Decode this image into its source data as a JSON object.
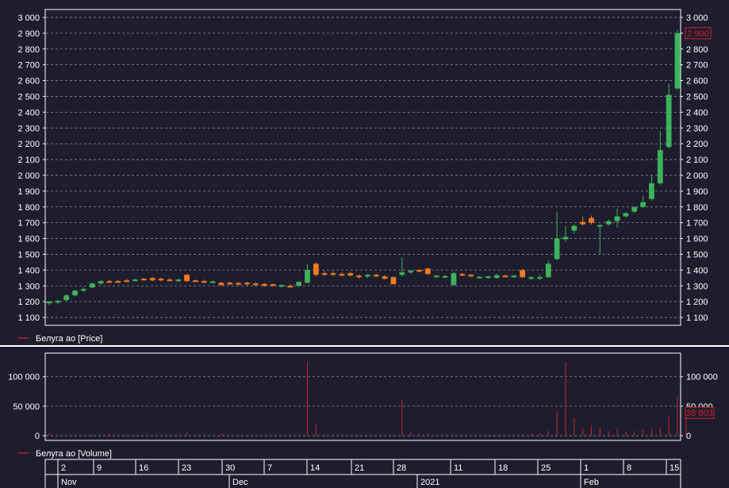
{
  "chart_data": [
    {
      "type": "candlestick",
      "panel": "price",
      "legend": "Белуга ао [Price]",
      "last_value_label": "2 900",
      "ylim": [
        1050,
        3050
      ],
      "y_ticks": [
        1100,
        1200,
        1300,
        1400,
        1500,
        1600,
        1700,
        1800,
        1900,
        2000,
        2100,
        2200,
        2300,
        2400,
        2500,
        2600,
        2700,
        2800,
        2900,
        3000
      ],
      "y_tick_labels": [
        "1 100",
        "1 200",
        "1 300",
        "1 400",
        "1 500",
        "1 600",
        "1 700",
        "1 800",
        "1 900",
        "2 000",
        "2 100",
        "2 200",
        "2 300",
        "2 400",
        "2 500",
        "2 600",
        "2 700",
        "2 800",
        "2 900",
        "3 000"
      ],
      "grid": true,
      "colors": {
        "up": "#3cb35a",
        "down": "#f47a1f",
        "accent": "#d0202a",
        "grid": "#8a8a9a",
        "axis": "#ffffff",
        "bg": "#1e1d2d"
      },
      "candles": [
        {
          "o": 1190,
          "h": 1205,
          "l": 1180,
          "c": 1200
        },
        {
          "o": 1200,
          "h": 1210,
          "l": 1185,
          "c": 1205
        },
        {
          "o": 1210,
          "h": 1245,
          "l": 1205,
          "c": 1240
        },
        {
          "o": 1240,
          "h": 1275,
          "l": 1235,
          "c": 1270
        },
        {
          "o": 1270,
          "h": 1290,
          "l": 1260,
          "c": 1280
        },
        {
          "o": 1290,
          "h": 1320,
          "l": 1285,
          "c": 1315
        },
        {
          "o": 1315,
          "h": 1335,
          "l": 1305,
          "c": 1330
        },
        {
          "o": 1330,
          "h": 1340,
          "l": 1320,
          "c": 1325
        },
        {
          "o": 1330,
          "h": 1338,
          "l": 1320,
          "c": 1325
        },
        {
          "o": 1335,
          "h": 1345,
          "l": 1325,
          "c": 1330
        },
        {
          "o": 1335,
          "h": 1345,
          "l": 1330,
          "c": 1340
        },
        {
          "o": 1345,
          "h": 1350,
          "l": 1335,
          "c": 1340
        },
        {
          "o": 1350,
          "h": 1355,
          "l": 1330,
          "c": 1335
        },
        {
          "o": 1345,
          "h": 1352,
          "l": 1330,
          "c": 1335
        },
        {
          "o": 1340,
          "h": 1350,
          "l": 1330,
          "c": 1335
        },
        {
          "o": 1335,
          "h": 1345,
          "l": 1325,
          "c": 1340
        },
        {
          "o": 1370,
          "h": 1375,
          "l": 1325,
          "c": 1330
        },
        {
          "o": 1335,
          "h": 1340,
          "l": 1325,
          "c": 1330
        },
        {
          "o": 1330,
          "h": 1340,
          "l": 1320,
          "c": 1325
        },
        {
          "o": 1325,
          "h": 1335,
          "l": 1320,
          "c": 1328
        },
        {
          "o": 1320,
          "h": 1325,
          "l": 1300,
          "c": 1305
        },
        {
          "o": 1320,
          "h": 1328,
          "l": 1305,
          "c": 1312
        },
        {
          "o": 1318,
          "h": 1325,
          "l": 1305,
          "c": 1310
        },
        {
          "o": 1320,
          "h": 1325,
          "l": 1300,
          "c": 1310
        },
        {
          "o": 1315,
          "h": 1322,
          "l": 1300,
          "c": 1305
        },
        {
          "o": 1312,
          "h": 1318,
          "l": 1295,
          "c": 1300
        },
        {
          "o": 1310,
          "h": 1315,
          "l": 1295,
          "c": 1300
        },
        {
          "o": 1300,
          "h": 1310,
          "l": 1290,
          "c": 1305
        },
        {
          "o": 1300,
          "h": 1310,
          "l": 1290,
          "c": 1298
        },
        {
          "o": 1300,
          "h": 1330,
          "l": 1295,
          "c": 1325
        },
        {
          "o": 1320,
          "h": 1440,
          "l": 1315,
          "c": 1400
        },
        {
          "o": 1440,
          "h": 1450,
          "l": 1360,
          "c": 1370
        },
        {
          "o": 1380,
          "h": 1395,
          "l": 1365,
          "c": 1375
        },
        {
          "o": 1380,
          "h": 1390,
          "l": 1360,
          "c": 1370
        },
        {
          "o": 1375,
          "h": 1385,
          "l": 1360,
          "c": 1370
        },
        {
          "o": 1380,
          "h": 1388,
          "l": 1360,
          "c": 1365
        },
        {
          "o": 1365,
          "h": 1372,
          "l": 1345,
          "c": 1355
        },
        {
          "o": 1362,
          "h": 1375,
          "l": 1350,
          "c": 1370
        },
        {
          "o": 1370,
          "h": 1378,
          "l": 1355,
          "c": 1365
        },
        {
          "o": 1360,
          "h": 1368,
          "l": 1340,
          "c": 1345
        },
        {
          "o": 1355,
          "h": 1360,
          "l": 1320,
          "c": 1310
        },
        {
          "o": 1370,
          "h": 1480,
          "l": 1360,
          "c": 1385
        },
        {
          "o": 1390,
          "h": 1400,
          "l": 1375,
          "c": 1395
        },
        {
          "o": 1400,
          "h": 1405,
          "l": 1385,
          "c": 1390
        },
        {
          "o": 1410,
          "h": 1415,
          "l": 1370,
          "c": 1375
        },
        {
          "o": 1360,
          "h": 1368,
          "l": 1350,
          "c": 1365
        },
        {
          "o": 1360,
          "h": 1368,
          "l": 1350,
          "c": 1362
        },
        {
          "o": 1305,
          "h": 1390,
          "l": 1300,
          "c": 1380
        },
        {
          "o": 1375,
          "h": 1382,
          "l": 1362,
          "c": 1368
        },
        {
          "o": 1370,
          "h": 1375,
          "l": 1355,
          "c": 1360
        },
        {
          "o": 1355,
          "h": 1362,
          "l": 1348,
          "c": 1358
        },
        {
          "o": 1355,
          "h": 1365,
          "l": 1345,
          "c": 1360
        },
        {
          "o": 1350,
          "h": 1375,
          "l": 1345,
          "c": 1368
        },
        {
          "o": 1365,
          "h": 1372,
          "l": 1355,
          "c": 1360
        },
        {
          "o": 1360,
          "h": 1368,
          "l": 1350,
          "c": 1365
        },
        {
          "o": 1400,
          "h": 1408,
          "l": 1350,
          "c": 1355
        },
        {
          "o": 1345,
          "h": 1360,
          "l": 1340,
          "c": 1355
        },
        {
          "o": 1345,
          "h": 1370,
          "l": 1338,
          "c": 1355
        },
        {
          "o": 1355,
          "h": 1460,
          "l": 1350,
          "c": 1440
        },
        {
          "o": 1470,
          "h": 1770,
          "l": 1460,
          "c": 1600
        },
        {
          "o": 1595,
          "h": 1680,
          "l": 1580,
          "c": 1610
        },
        {
          "o": 1650,
          "h": 1690,
          "l": 1630,
          "c": 1680
        },
        {
          "o": 1705,
          "h": 1740,
          "l": 1680,
          "c": 1690
        },
        {
          "o": 1730,
          "h": 1745,
          "l": 1690,
          "c": 1700
        },
        {
          "o": 1680,
          "h": 1690,
          "l": 1500,
          "c": 1685
        },
        {
          "o": 1690,
          "h": 1720,
          "l": 1680,
          "c": 1710
        },
        {
          "o": 1710,
          "h": 1790,
          "l": 1670,
          "c": 1740
        },
        {
          "o": 1740,
          "h": 1770,
          "l": 1730,
          "c": 1760
        },
        {
          "o": 1770,
          "h": 1800,
          "l": 1760,
          "c": 1800
        },
        {
          "o": 1800,
          "h": 1870,
          "l": 1790,
          "c": 1830
        },
        {
          "o": 1850,
          "h": 2000,
          "l": 1840,
          "c": 1950
        },
        {
          "o": 1950,
          "h": 2280,
          "l": 1940,
          "c": 2160
        },
        {
          "o": 2180,
          "h": 2580,
          "l": 2170,
          "c": 2510
        },
        {
          "o": 2550,
          "h": 2920,
          "l": 2540,
          "c": 2900
        }
      ]
    },
    {
      "type": "bar",
      "panel": "volume",
      "legend": "Белуга ао [Volume]",
      "last_value_label": "38 803",
      "ylim": [
        -8000,
        140000
      ],
      "y_ticks": [
        0,
        50000,
        100000
      ],
      "y_tick_labels": [
        "0",
        "50 000",
        "100 000"
      ],
      "grid": true,
      "values": [
        4000,
        1200,
        1000,
        1200,
        1000,
        2500,
        2000,
        3500,
        1200,
        1500,
        1000,
        800,
        1000,
        1200,
        1000,
        1200,
        5000,
        1500,
        2000,
        1200,
        3500,
        1200,
        1500,
        1000,
        1200,
        800,
        1200,
        1000,
        1500,
        1200,
        124000,
        20000,
        2000,
        3000,
        2000,
        1500,
        1200,
        1200,
        1000,
        800,
        1200,
        60000,
        6000,
        4000,
        3000,
        2000,
        1500,
        1200,
        1500,
        1200,
        1000,
        1200,
        1500,
        2000,
        1800,
        2500,
        3500,
        4000,
        8000,
        42000,
        125000,
        30000,
        12000,
        18000,
        14000,
        8000,
        12000,
        7000,
        8000,
        10000,
        12000,
        14000,
        33000,
        65000,
        38803
      ]
    }
  ],
  "x_axis": {
    "day_labels": [
      "2",
      "9",
      "16",
      "23",
      "30",
      "7",
      "14",
      "21",
      "28",
      "11",
      "18",
      "25",
      "1",
      "8",
      "15"
    ],
    "month_labels": [
      "Nov",
      "Dec",
      "2021",
      "Feb"
    ]
  }
}
